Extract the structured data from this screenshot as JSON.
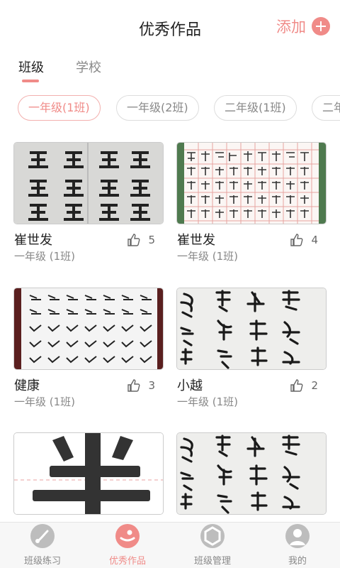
{
  "header": {
    "title": "优秀作品",
    "add_label": "添加"
  },
  "tabs": [
    {
      "label": "班级"
    },
    {
      "label": "学校"
    }
  ],
  "class_chips": [
    {
      "label": "一年级(1班)"
    },
    {
      "label": "一年级(2班)"
    },
    {
      "label": "二年级(1班)"
    },
    {
      "label": "二年"
    }
  ],
  "works": [
    {
      "name": "崔世发",
      "likes": "5",
      "class": "一年级 (1班)"
    },
    {
      "name": "崔世发",
      "likes": "4",
      "class": "一年级 (1班)"
    },
    {
      "name": "健康",
      "likes": "3",
      "class": "一年级 (1班)"
    },
    {
      "name": "小越",
      "likes": "2",
      "class": "一年级 (1班)"
    },
    {
      "name": "",
      "likes": "",
      "class": ""
    },
    {
      "name": "",
      "likes": "",
      "class": ""
    }
  ],
  "bottom_nav": [
    {
      "label": "班级练习",
      "icon": "brush-icon"
    },
    {
      "label": "优秀作品",
      "icon": "featured-icon"
    },
    {
      "label": "班级管理",
      "icon": "manage-icon"
    },
    {
      "label": "我的",
      "icon": "profile-icon"
    }
  ],
  "colors": {
    "accent": "#f08b88",
    "muted": "#888888"
  }
}
